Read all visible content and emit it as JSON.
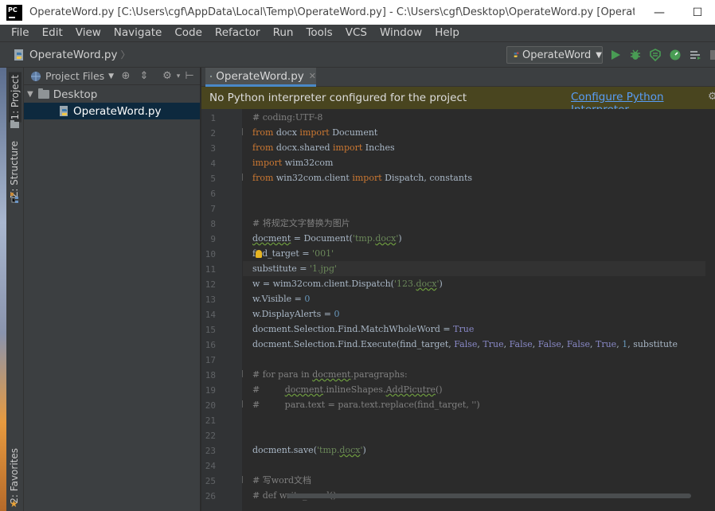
{
  "window": {
    "title": "OperateWord.py [C:\\Users\\cgf\\AppData\\Local\\Temp\\OperateWord.py] - C:\\Users\\cgf\\Desktop\\OperateWord.py [OperateWord.p...",
    "app_icon_text": "PC",
    "minimize": "—",
    "maximize": "☐"
  },
  "menu": [
    "File",
    "Edit",
    "View",
    "Navigate",
    "Code",
    "Refactor",
    "Run",
    "Tools",
    "VCS",
    "Window",
    "Help"
  ],
  "navbar": {
    "breadcrumb": "OperateWord.py",
    "run_config": "OperateWord"
  },
  "tool_windows": {
    "project": "1: Project",
    "structure": "Z: Structure",
    "favorites": "2: Favorites"
  },
  "project_panel": {
    "header": "Project Files",
    "tree": [
      {
        "label": "Desktop",
        "type": "folder"
      },
      {
        "label": "OperateWord.py",
        "type": "python-file"
      }
    ]
  },
  "editor": {
    "tab": "OperateWord.py",
    "warning": "No Python interpreter configured for the project",
    "warning_link": "Configure Python Interpreter",
    "line_numbers": [
      "1",
      "2",
      "3",
      "4",
      "5",
      "6",
      "7",
      "8",
      "9",
      "10",
      "11",
      "12",
      "13",
      "14",
      "15",
      "16",
      "17",
      "18",
      "19",
      "20",
      "21",
      "22",
      "23",
      "24",
      "25",
      "26"
    ],
    "code": {
      "l1": "# coding:UTF-8",
      "l2_a": "from",
      "l2_b": " docx ",
      "l2_c": "import",
      "l2_d": " Document",
      "l3_a": "from",
      "l3_b": " docx.shared ",
      "l3_c": "import",
      "l3_d": " Inches",
      "l4_a": "import",
      "l4_b": " wim32com",
      "l5_a": "from",
      "l5_b": " win32com.client ",
      "l5_c": "import",
      "l5_d": " Dispatch, constants",
      "l8": "# 将规定文字替换为图片",
      "l9_a": "docment",
      "l9_b": " = Document(",
      "l9_c": "'tmp.",
      "l9_d": "docx",
      "l9_e": "'",
      "l9_f": ")",
      "l10_a": "f",
      "l10_b": "d_target = ",
      "l10_c": "'001'",
      "l11_a": "substitute = ",
      "l11_b": "'1.jpg'",
      "l12_a": "w = wim32com.client.Dispatch(",
      "l12_b": "'123.",
      "l12_c": "docx",
      "l12_d": "'",
      "l12_e": ")",
      "l13_a": "w.Visible = ",
      "l13_b": "0",
      "l14_a": "w.DisplayAlerts = ",
      "l14_b": "0",
      "l15_a": "docment.Selection.Find.MatchWholeWord = ",
      "l15_b": "True",
      "l16_a": "docment.Selection.Find.Execute(find_target, ",
      "l16_b": "False",
      "l16_c": ", ",
      "l16_d": "True",
      "l16_e": ", ",
      "l16_f": "False",
      "l16_g": ", ",
      "l16_h": "False",
      "l16_i": ", ",
      "l16_j": "False",
      "l16_k": ", ",
      "l16_l": "True",
      "l16_m": ", ",
      "l16_n": "1",
      "l16_o": ", substitute",
      "l18_a": "# for para in ",
      "l18_b": "docment",
      "l18_c": ".paragraphs:",
      "l19_a": "#         ",
      "l19_b": "docment",
      "l19_c": ".inlineShapes.",
      "l19_d": "AddPicutre",
      "l19_e": "()",
      "l20": "#         para.text = para.text.replace(find_target, '')",
      "l23_a": "docment.save(",
      "l23_b": "'tmp.",
      "l23_c": "docx",
      "l23_d": "'",
      "l23_e": ")",
      "l25": "# 写word文档",
      "l26": "# def write_word():"
    }
  },
  "colors": {
    "keyword": "#cc7832",
    "comment": "#808080",
    "string": "#6a8759",
    "number": "#6897bb",
    "builtin_const": "#8888c6",
    "warning_bg": "#49451f",
    "link": "#589df6",
    "selection": "#0d293e",
    "run": "#499c54"
  }
}
